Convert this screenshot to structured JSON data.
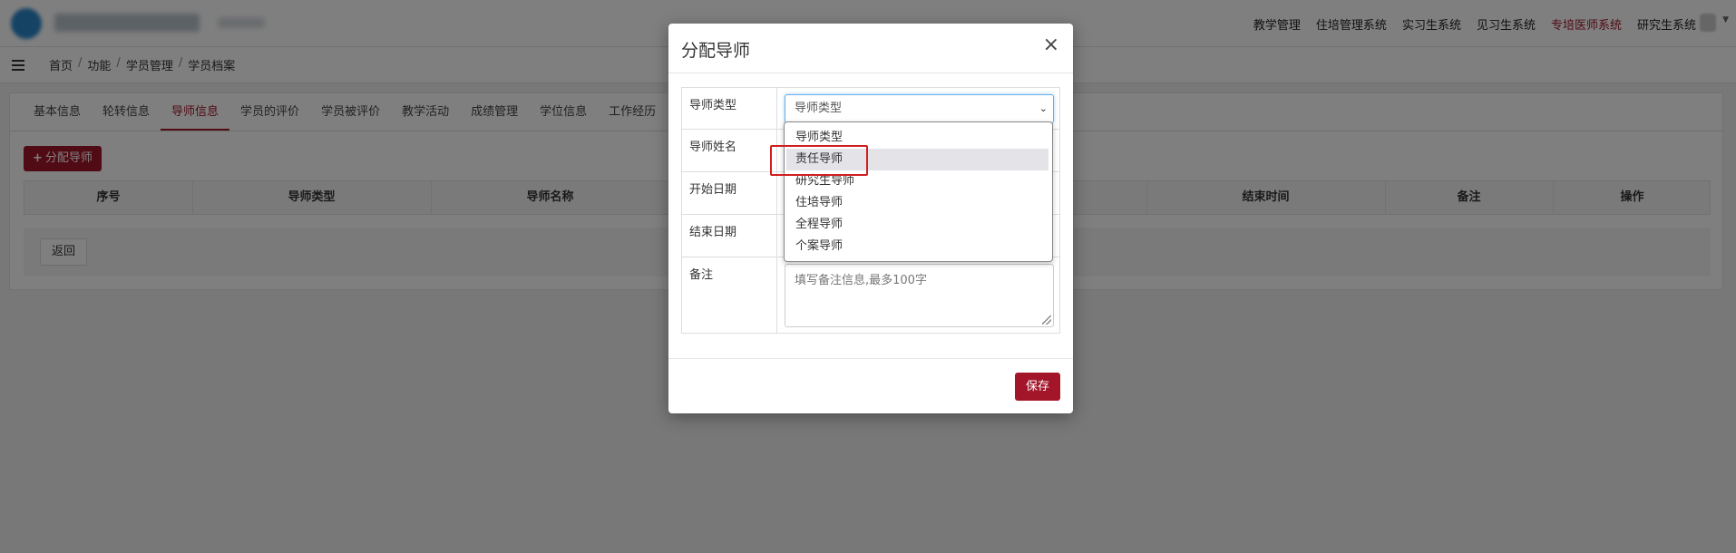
{
  "topnav": {
    "items": [
      "教学管理",
      "住培管理系统",
      "实习生系统",
      "见习生系统",
      "专培医师系统",
      "研究生系统"
    ],
    "active_index": 4
  },
  "breadcrumb": [
    "首页",
    "功能",
    "学员管理",
    "学员档案"
  ],
  "tabs": [
    "基本信息",
    "轮转信息",
    "导师信息",
    "学员的评价",
    "学员被评价",
    "教学活动",
    "成绩管理",
    "学位信息",
    "工作经历"
  ],
  "active_tab": 2,
  "add_button": "分配导师",
  "table": {
    "columns": [
      "序号",
      "导师类型",
      "导师名称",
      "结束时间",
      "备注",
      "操作"
    ]
  },
  "back_button": "返回",
  "modal": {
    "title": "分配导师",
    "close": "×",
    "fields": {
      "type_label": "导师类型",
      "name_label": "导师姓名",
      "start_label": "开始日期",
      "end_label": "结束日期",
      "note_label": "备注"
    },
    "select_value": "导师类型",
    "note_placeholder": "填写备注信息,最多100字",
    "options": [
      "导师类型",
      "责任导师",
      "研究生导师",
      "住培导师",
      "全程导师",
      "个案导师"
    ],
    "highlighted_option": 1,
    "save": "保存"
  },
  "colors": {
    "brand": "#a3162a",
    "focus": "#66afe9",
    "annotation": "#d11f1f"
  }
}
